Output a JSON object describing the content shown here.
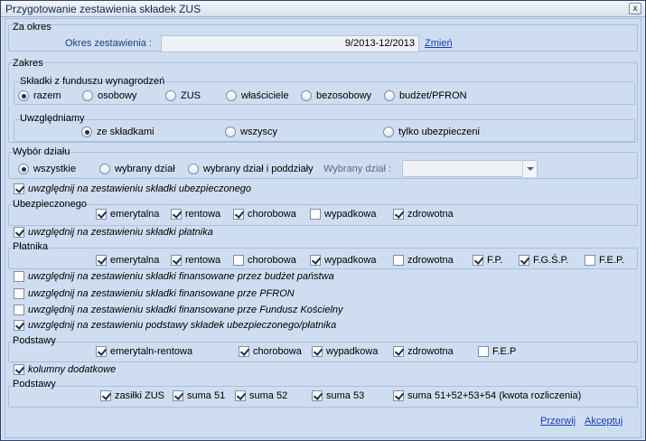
{
  "window": {
    "title": "Przygotowanie zestawienia składek ZUS",
    "close_label": "x"
  },
  "za_okres": {
    "label": "Za okres",
    "okres_label": "Okres zestawienia :",
    "okres_value": "9/2013-12/2013",
    "zmien": "Zmień"
  },
  "zakres": {
    "label": "Zakres",
    "skladki": {
      "label": "Składki z funduszu wynagrodzeń",
      "options": [
        "razem",
        "osobowy",
        "ZUS",
        "właściciele",
        "bezosobowy",
        "budżet/PFRON"
      ],
      "selected": "razem"
    },
    "uwzgledniamy": {
      "label": "Uwzględniamy",
      "options": [
        "ze składkami",
        "wszyscy",
        "tylko ubezpieczeni"
      ],
      "selected": "ze składkami"
    }
  },
  "wybor_dzialu": {
    "label": "Wybór działu",
    "options": [
      "wszystkie",
      "wybrany dział",
      "wybrany dział i poddziały"
    ],
    "selected": "wszystkie",
    "wybrany_label": "Wybrany dział :",
    "wybrany_value": ""
  },
  "ubezpieczonego": {
    "toggle": {
      "label": "uwzględnij na zestawieniu składki ubezpieczonego",
      "checked": true
    },
    "group_label": "Ubezpieczonego",
    "items": [
      {
        "label": "emerytalna",
        "checked": true
      },
      {
        "label": "rentowa",
        "checked": true
      },
      {
        "label": "chorobowa",
        "checked": true
      },
      {
        "label": "wypadkowa",
        "checked": false
      },
      {
        "label": "zdrowotna",
        "checked": true
      }
    ]
  },
  "platnika": {
    "toggle": {
      "label": "uwzględnij na zestawieniu składki płatnika",
      "checked": true
    },
    "group_label": "Płatnika",
    "items": [
      {
        "label": "emerytalna",
        "checked": true
      },
      {
        "label": "rentowa",
        "checked": true
      },
      {
        "label": "chorobowa",
        "checked": false
      },
      {
        "label": "wypadkowa",
        "checked": true
      },
      {
        "label": "zdrowotna",
        "checked": false
      },
      {
        "label": "F.P.",
        "checked": true
      },
      {
        "label": "F.G.Ś.P.",
        "checked": true
      },
      {
        "label": "F.E.P.",
        "checked": false
      }
    ]
  },
  "extra": [
    {
      "label": "uwzględnij na zestawieniu składki finansowane przez budżet państwa",
      "checked": false
    },
    {
      "label": "uwzględnij na zestawieniu składki finansowane prze PFRON",
      "checked": false
    },
    {
      "label": "uwzględnij na zestawieniu składki finansowane prze Fundusz Kościelny",
      "checked": false
    },
    {
      "label": "uwzględnij na zestawieniu podstawy składek ubezpieczonego/płatnika",
      "checked": true
    }
  ],
  "podstawy1": {
    "group_label": "Podstawy",
    "items": [
      {
        "label": "emerytaln-rentowa",
        "checked": true
      },
      {
        "label": "chorobowa",
        "checked": true
      },
      {
        "label": "wypadkowa",
        "checked": true
      },
      {
        "label": "zdrowotna",
        "checked": true
      },
      {
        "label": "F.E.P",
        "checked": false
      }
    ]
  },
  "kolumny": {
    "label": "kolumny dodatkowe",
    "checked": true
  },
  "podstawy2": {
    "group_label": "Podstawy",
    "items": [
      {
        "label": "zasiłki ZUS",
        "checked": true
      },
      {
        "label": "suma 51",
        "checked": true
      },
      {
        "label": "suma 52",
        "checked": true
      },
      {
        "label": "suma 53",
        "checked": true
      },
      {
        "label": "suma 51+52+53+54 (kwota rozliczenia)",
        "checked": true
      }
    ]
  },
  "footer": {
    "przerwij": "Przerwij",
    "akceptuj": "Akceptuj"
  }
}
